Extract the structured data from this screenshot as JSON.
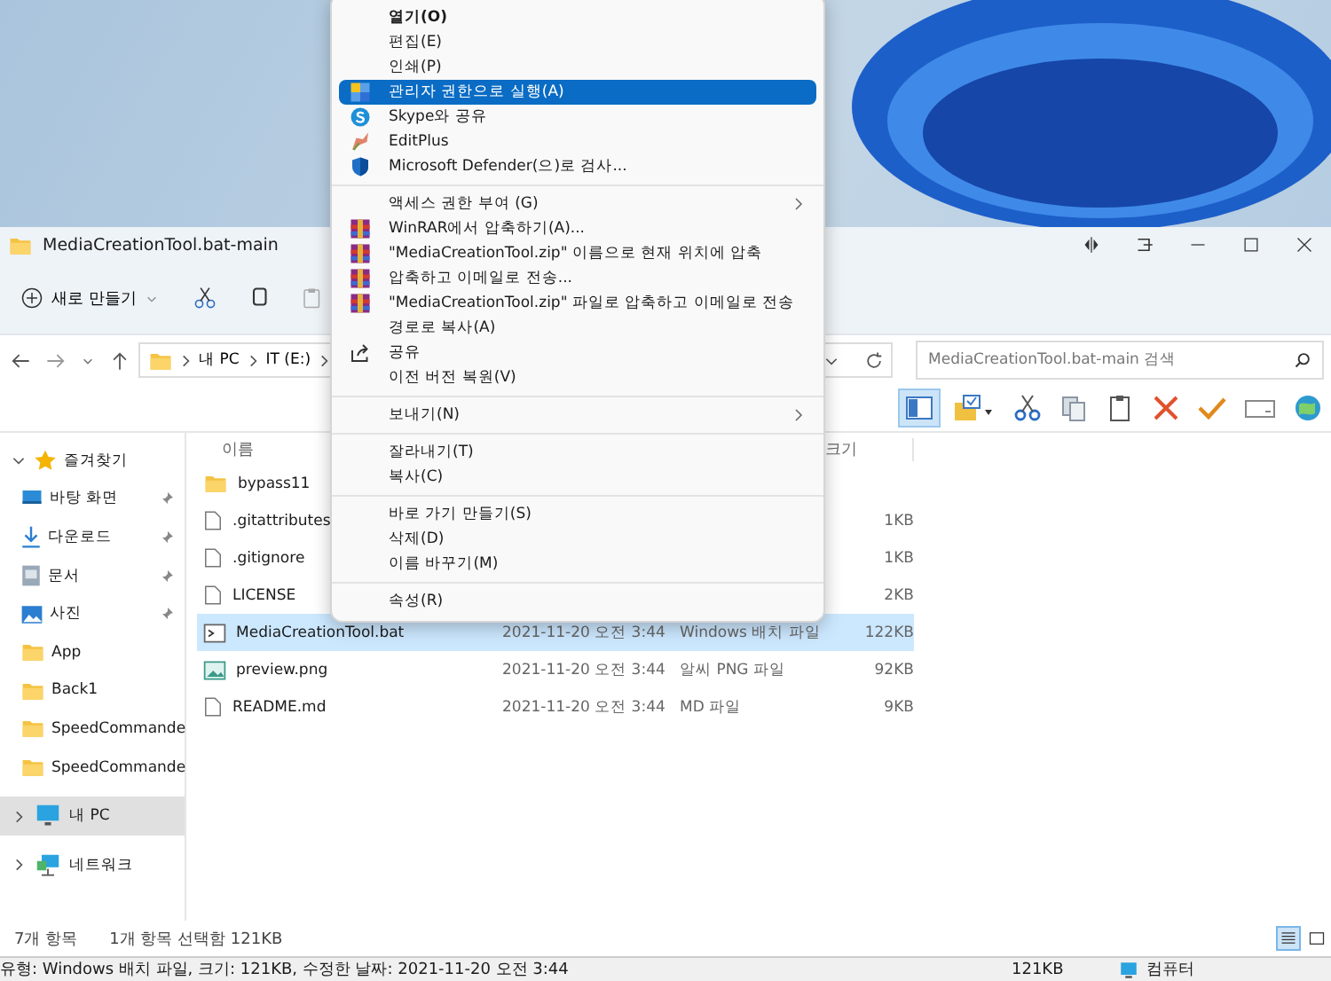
{
  "window": {
    "title": "MediaCreationTool.bat-main"
  },
  "command_bar": {
    "new_button": "새로 만들기"
  },
  "address": {
    "crumbs": [
      "내 PC",
      "IT (E:)"
    ],
    "search_placeholder": "MediaCreationTool.bat-main 검색"
  },
  "toolbar": {
    "pane_selected": true
  },
  "sidebar": {
    "items": [
      {
        "label": "즐겨찾기",
        "kind": "star",
        "expanded": true,
        "selected": false,
        "children": [
          {
            "label": "바탕 화면",
            "kind": "desktop",
            "pinned": true
          },
          {
            "label": "다운로드",
            "kind": "download",
            "pinned": true
          },
          {
            "label": "문서",
            "kind": "document",
            "pinned": true
          },
          {
            "label": "사진",
            "kind": "picture",
            "pinned": true
          },
          {
            "label": "App",
            "kind": "folder",
            "pinned": false
          },
          {
            "label": "Back1",
            "kind": "folder",
            "pinned": false
          },
          {
            "label": "SpeedCommande",
            "kind": "folder",
            "pinned": false
          },
          {
            "label": "SpeedCommande",
            "kind": "folder",
            "pinned": false
          }
        ]
      },
      {
        "label": "내 PC",
        "kind": "pc",
        "expanded": false,
        "selected": true
      },
      {
        "label": "네트워크",
        "kind": "network",
        "expanded": false,
        "selected": false
      }
    ]
  },
  "table": {
    "columns": [
      "이름",
      "크기"
    ],
    "rows": [
      {
        "name": "bypass11",
        "kind": "folder",
        "selected": false
      },
      {
        "name": ".gitattributes",
        "kind": "file",
        "size": "1KB",
        "selected": false
      },
      {
        "name": ".gitignore",
        "kind": "file",
        "size": "1KB",
        "selected": false
      },
      {
        "name": "LICENSE",
        "kind": "file",
        "size": "2KB",
        "selected": false
      },
      {
        "name": "MediaCreationTool.bat",
        "kind": "batch",
        "date": "2021-11-20 오전 3:44",
        "type": "Windows 배치 파일",
        "size": "122KB",
        "selected": true
      },
      {
        "name": "preview.png",
        "kind": "image",
        "date": "2021-11-20 오전 3:44",
        "type": "알씨 PNG 파일",
        "size": "92KB",
        "selected": false
      },
      {
        "name": "README.md",
        "kind": "file",
        "date": "2021-11-20 오전 3:44",
        "type": "MD 파일",
        "size": "9KB",
        "selected": false
      }
    ]
  },
  "status": {
    "count": "7개 항목",
    "selection": "1개 항목 선택함 121KB",
    "details_view": true
  },
  "status_bar": {
    "details": "유형: Windows 배치 파일, 크기: 121KB, 수정한 날짜: 2021-11-20 오전 3:44",
    "size": "121KB",
    "zone": "컴퓨터"
  },
  "context_menu": {
    "groups": [
      [
        {
          "label": "열기(O)",
          "kind": "plain",
          "default": true,
          "submenu": false,
          "selected": false
        },
        {
          "label": "편집(E)",
          "kind": "plain",
          "default": false,
          "submenu": false,
          "selected": false
        },
        {
          "label": "인쇄(P)",
          "kind": "plain",
          "default": false,
          "submenu": false,
          "selected": false
        },
        {
          "label": "관리자 권한으로 실행(A)",
          "kind": "shield",
          "default": false,
          "submenu": false,
          "selected": true
        },
        {
          "label": "Skype와 공유",
          "kind": "skype",
          "default": false,
          "submenu": false,
          "selected": false
        },
        {
          "label": "EditPlus",
          "kind": "editplus",
          "default": false,
          "submenu": false,
          "selected": false
        },
        {
          "label": "Microsoft Defender(으)로 검사...",
          "kind": "defender",
          "default": false,
          "submenu": false,
          "selected": false
        }
      ],
      [
        {
          "label": "액세스 권한 부여 (G)",
          "kind": "plain",
          "default": false,
          "submenu": true,
          "selected": false
        },
        {
          "label": "WinRAR에서 압축하기(A)...",
          "kind": "winrar",
          "default": false,
          "submenu": false,
          "selected": false
        },
        {
          "label": "\"MediaCreationTool.zip\" 이름으로 현재 위치에 압축",
          "kind": "winrar",
          "default": false,
          "submenu": false,
          "selected": false
        },
        {
          "label": "압축하고 이메일로 전송...",
          "kind": "winrar",
          "default": false,
          "submenu": false,
          "selected": false
        },
        {
          "label": "\"MediaCreationTool.zip\" 파일로 압축하고 이메일로 전송",
          "kind": "winrar",
          "default": false,
          "submenu": false,
          "selected": false
        },
        {
          "label": "경로로 복사(A)",
          "kind": "plain",
          "default": false,
          "submenu": false,
          "selected": false
        },
        {
          "label": "공유",
          "kind": "share",
          "default": false,
          "submenu": false,
          "selected": false
        },
        {
          "label": "이전 버전 복원(V)",
          "kind": "plain",
          "default": false,
          "submenu": false,
          "selected": false
        }
      ],
      [
        {
          "label": "보내기(N)",
          "kind": "plain",
          "default": false,
          "submenu": true,
          "selected": false
        }
      ],
      [
        {
          "label": "잘라내기(T)",
          "kind": "plain",
          "default": false,
          "submenu": false,
          "selected": false
        },
        {
          "label": "복사(C)",
          "kind": "plain",
          "default": false,
          "submenu": false,
          "selected": false
        }
      ],
      [
        {
          "label": "바로 가기 만들기(S)",
          "kind": "plain",
          "default": false,
          "submenu": false,
          "selected": false
        },
        {
          "label": "삭제(D)",
          "kind": "plain",
          "default": false,
          "submenu": false,
          "selected": false
        },
        {
          "label": "이름 바꾸기(M)",
          "kind": "plain",
          "default": false,
          "submenu": false,
          "selected": false
        }
      ],
      [
        {
          "label": "속성(R)",
          "kind": "plain",
          "default": false,
          "submenu": false,
          "selected": false
        }
      ]
    ]
  }
}
